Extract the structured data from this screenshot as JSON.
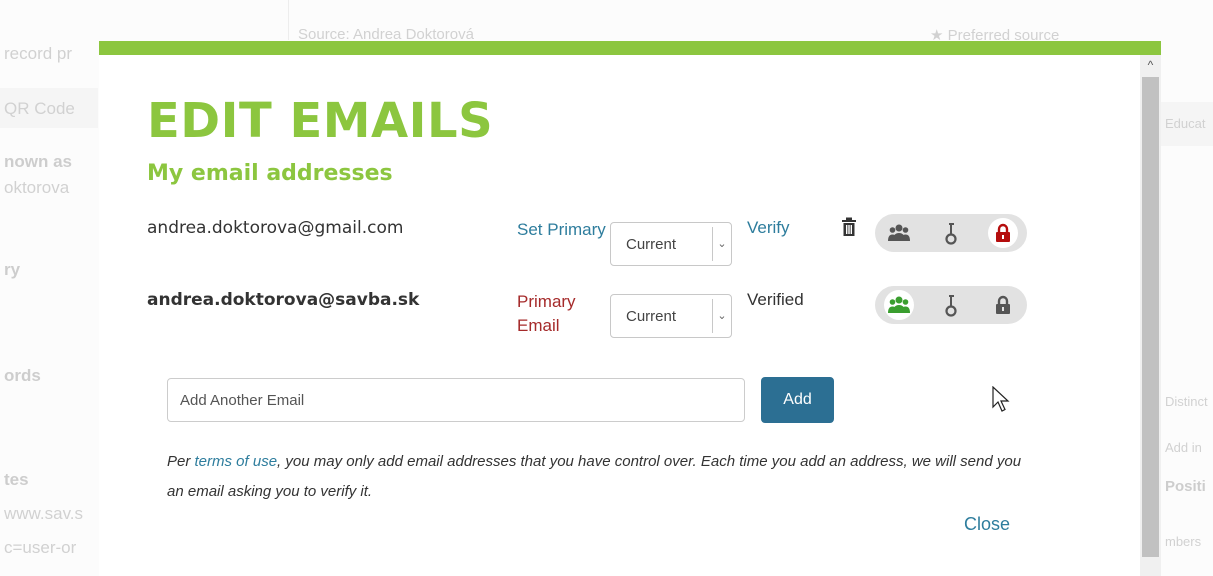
{
  "background": {
    "left_column": [
      "record pr",
      "QR Code",
      "nown as",
      "oktorova",
      "ry",
      "ords",
      "tes",
      "www.sav.s",
      "c=user-or"
    ],
    "top_center": "Source: Andrea Doktorová",
    "top_right": "★ Preferred source",
    "right_column": [
      "Educat",
      "Distinct",
      "Add in",
      "Positi",
      "mbers"
    ]
  },
  "modal": {
    "title": "EDIT EMAILS",
    "subtitle": "My email addresses",
    "emails": [
      {
        "address": "andrea.doktorova@gmail.com",
        "action_label": "Set Primary",
        "status": "Current",
        "verify_label": "Verify",
        "visibility": "private"
      },
      {
        "address": "andrea.doktorova@savba.sk",
        "action_label": "Primary Email",
        "status": "Current",
        "verify_label": "Verified",
        "visibility": "everyone"
      }
    ],
    "add": {
      "placeholder": "Add Another Email",
      "button_label": "Add"
    },
    "note": {
      "prefix": "Per ",
      "link": "terms of use",
      "suffix": ", you may only add email addresses that you have control over. Each time you add an address, we will send you an email asking you to verify it."
    },
    "close_label": "Close"
  },
  "colors": {
    "brand_green": "#8cc63f",
    "link_blue": "#2e7d9d",
    "primary_red": "#a52a2a",
    "button_blue": "#2c6f93",
    "everyone_green": "#3a9e2f",
    "private_red": "#b50d0d"
  },
  "icons": [
    "trash-icon",
    "everyone-icon",
    "trusted-key-icon",
    "private-lock-icon",
    "chevron-down-icon",
    "scroll-up-icon",
    "mouse-pointer-icon"
  ]
}
